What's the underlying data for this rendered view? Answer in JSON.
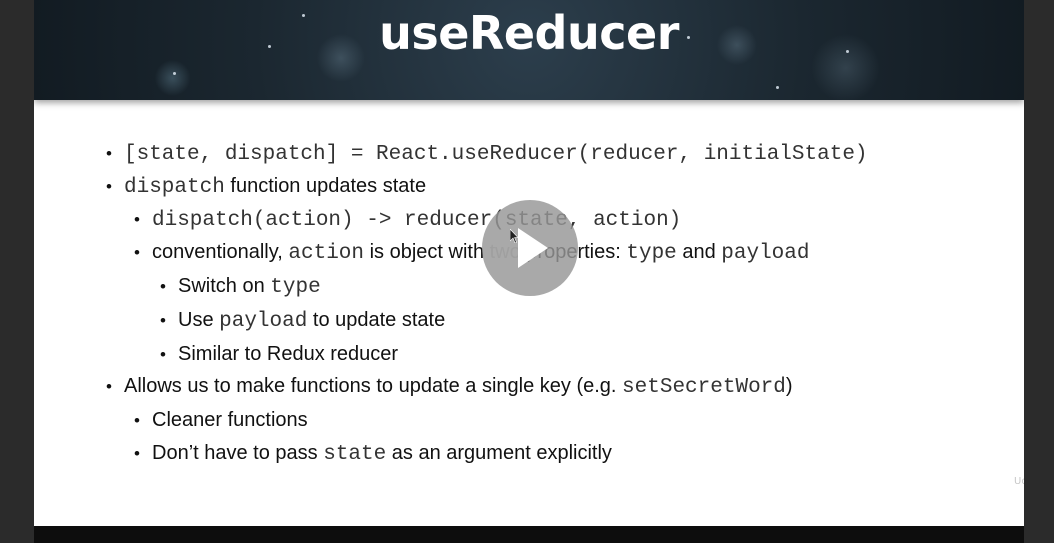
{
  "slide": {
    "title": "useReducer"
  },
  "bullets": {
    "l1": "[state, dispatch] = React.useReducer(reducer, initialState)",
    "l2_code": "dispatch",
    "l2_text": " function updates state",
    "l3": "dispatch(action) -> reducer(state, action)",
    "l4_a": "conventionally, ",
    "l4_code1": "action",
    "l4_b": " is object with ",
    "l4_faint": "two",
    "l4_c": " properties: ",
    "l4_code2": "type",
    "l4_d": " and ",
    "l4_code3": "payload",
    "l5_text": "Switch on ",
    "l5_code": "type",
    "l6_a": "Use ",
    "l6_code": "payload",
    "l6_b": " to update state",
    "l7": "Similar to Redux reducer",
    "l8_a": "Allows us to make functions to update a single key (e.g. ",
    "l8_code": "setSecretWord",
    "l8_b": ")",
    "l9": "Cleaner functions",
    "l10_a": "Don’t have to pass ",
    "l10_code": "state",
    "l10_b": " as an argument explicitly"
  },
  "bullet_glyph": "•",
  "watermark": "Udemy",
  "video": {
    "play_icon": "play-icon",
    "accent": "#969696"
  }
}
